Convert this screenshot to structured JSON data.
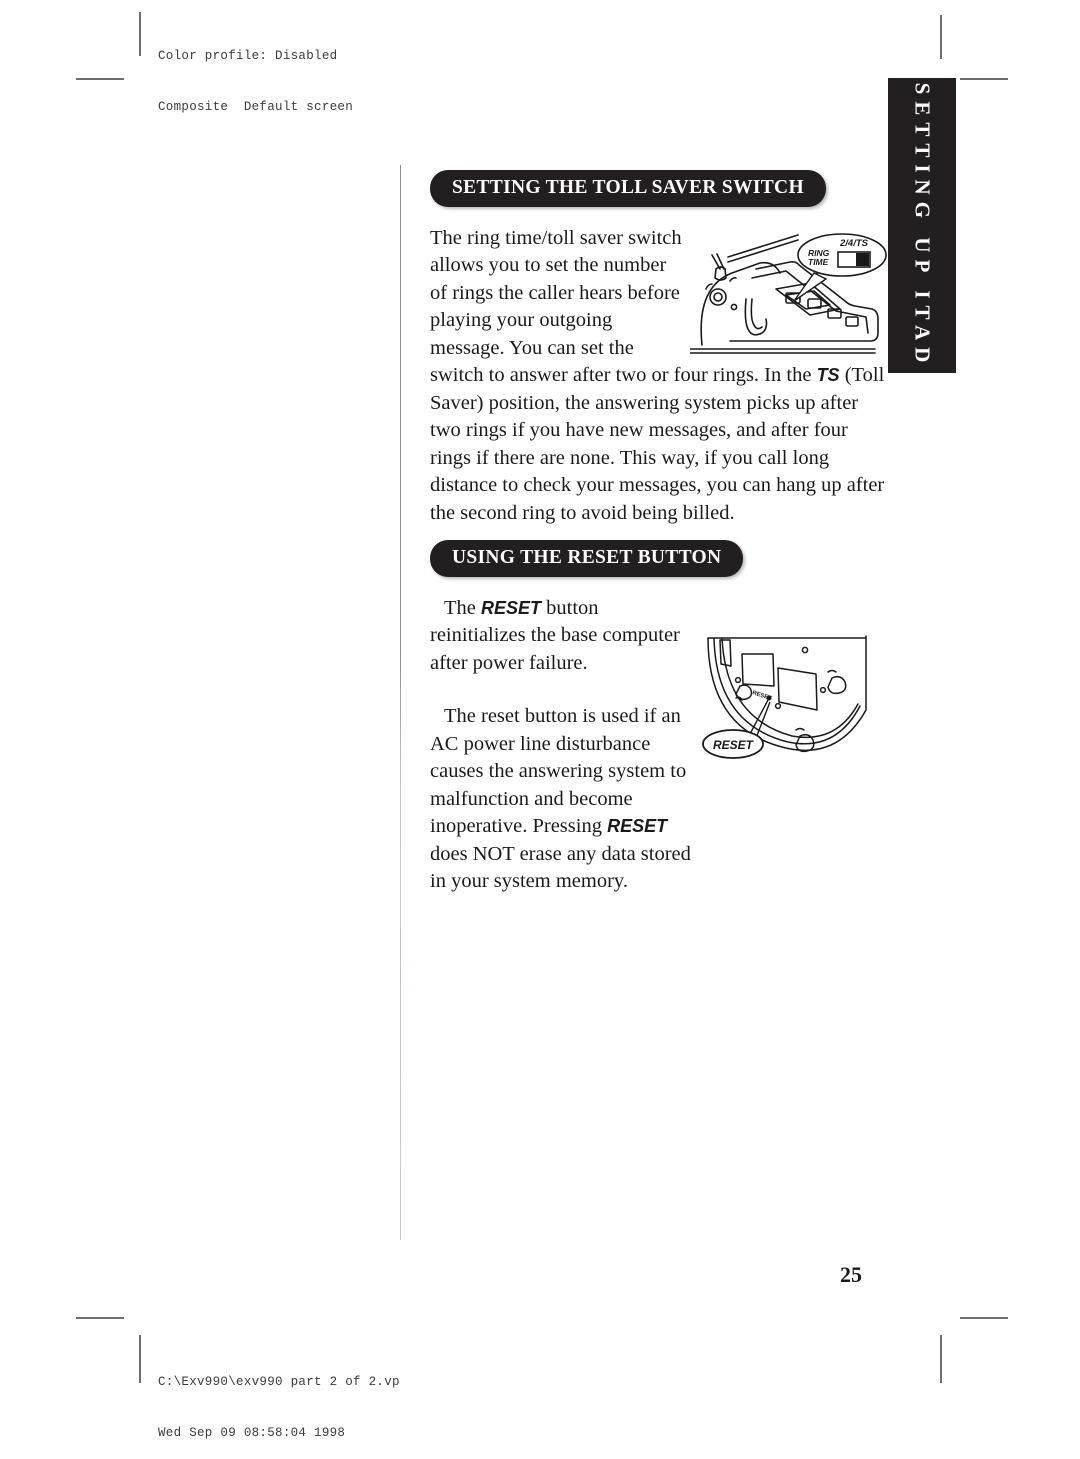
{
  "printer_header": {
    "line1": "Color profile: Disabled",
    "line2": "Composite  Default screen"
  },
  "printer_footer": {
    "line1": "C:\\Exv990\\exv990 part 2 of 2.vp",
    "line2": "Wed Sep 09 08:58:04 1998"
  },
  "side_tab": {
    "label": "SETTING UP ITAD"
  },
  "page_number": "25",
  "sections": [
    {
      "heading": "SETTING THE TOLL SAVER SWITCH",
      "paragraph_1_part_1": "The ring time/toll saver switch allows you to set the number of rings the caller hears before playing your outgoing message. You can set the switch to answer after two or four rings. In the ",
      "paragraph_1_keyword": "TS",
      "paragraph_1_part_2": " (Toll Saver) position, the answering system picks up after two rings if you have new messages, and after four rings if there are none. This way, if you call long distance to check your messages, you can hang up after the second ring to avoid being billed."
    },
    {
      "heading": "USING THE RESET BUTTON",
      "paragraph_1_part_1": "The ",
      "paragraph_1_keyword": "RESET",
      "paragraph_1_part_2": " button reinitializes the base computer after power failure.",
      "paragraph_2_part_1": "The reset button is used if an AC power line disturbance causes the answering system to malfunction and become inoperative. Pressing ",
      "paragraph_2_keyword": "RESET",
      "paragraph_2_part_2": " does NOT erase any data stored in your system memory."
    }
  ],
  "illustration_toll_saver": {
    "callout_top": "2/4/TS",
    "callout_line1": "RING",
    "callout_line2": "TIME"
  },
  "illustration_reset": {
    "callout_label": "RESET",
    "base_label": "RESET"
  },
  "colors": {
    "ink": "#231f20",
    "paper": "#ffffff",
    "rule": "#8c8c8c",
    "rule_tint": "#d6bede"
  }
}
